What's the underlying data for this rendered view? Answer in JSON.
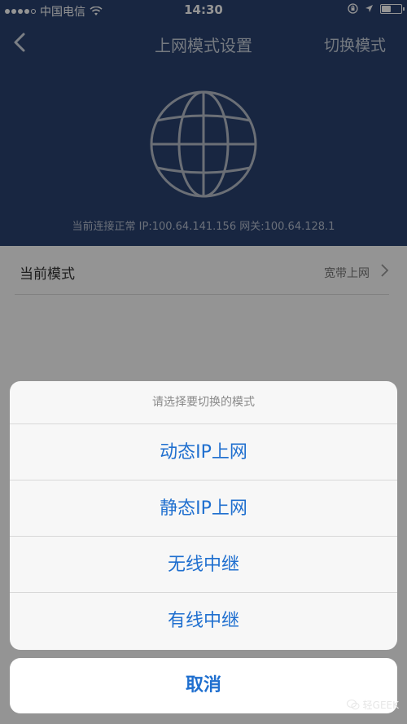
{
  "status_bar": {
    "carrier": "中国电信",
    "time": "14:30"
  },
  "nav": {
    "title": "上网模式设置",
    "action": "切换模式"
  },
  "connection_status": "当前连接正常 IP:100.64.141.156 网关:100.64.128.1",
  "current_mode_row": {
    "label": "当前模式",
    "value": "宽带上网"
  },
  "action_sheet": {
    "title": "请选择要切换的模式",
    "options": [
      "动态IP上网",
      "静态IP上网",
      "无线中继",
      "有线中继"
    ],
    "cancel": "取消"
  },
  "watermark": "轻GEEK",
  "colors": {
    "header_bg": "#2a4270",
    "accent_blue": "#1f6fcf"
  }
}
